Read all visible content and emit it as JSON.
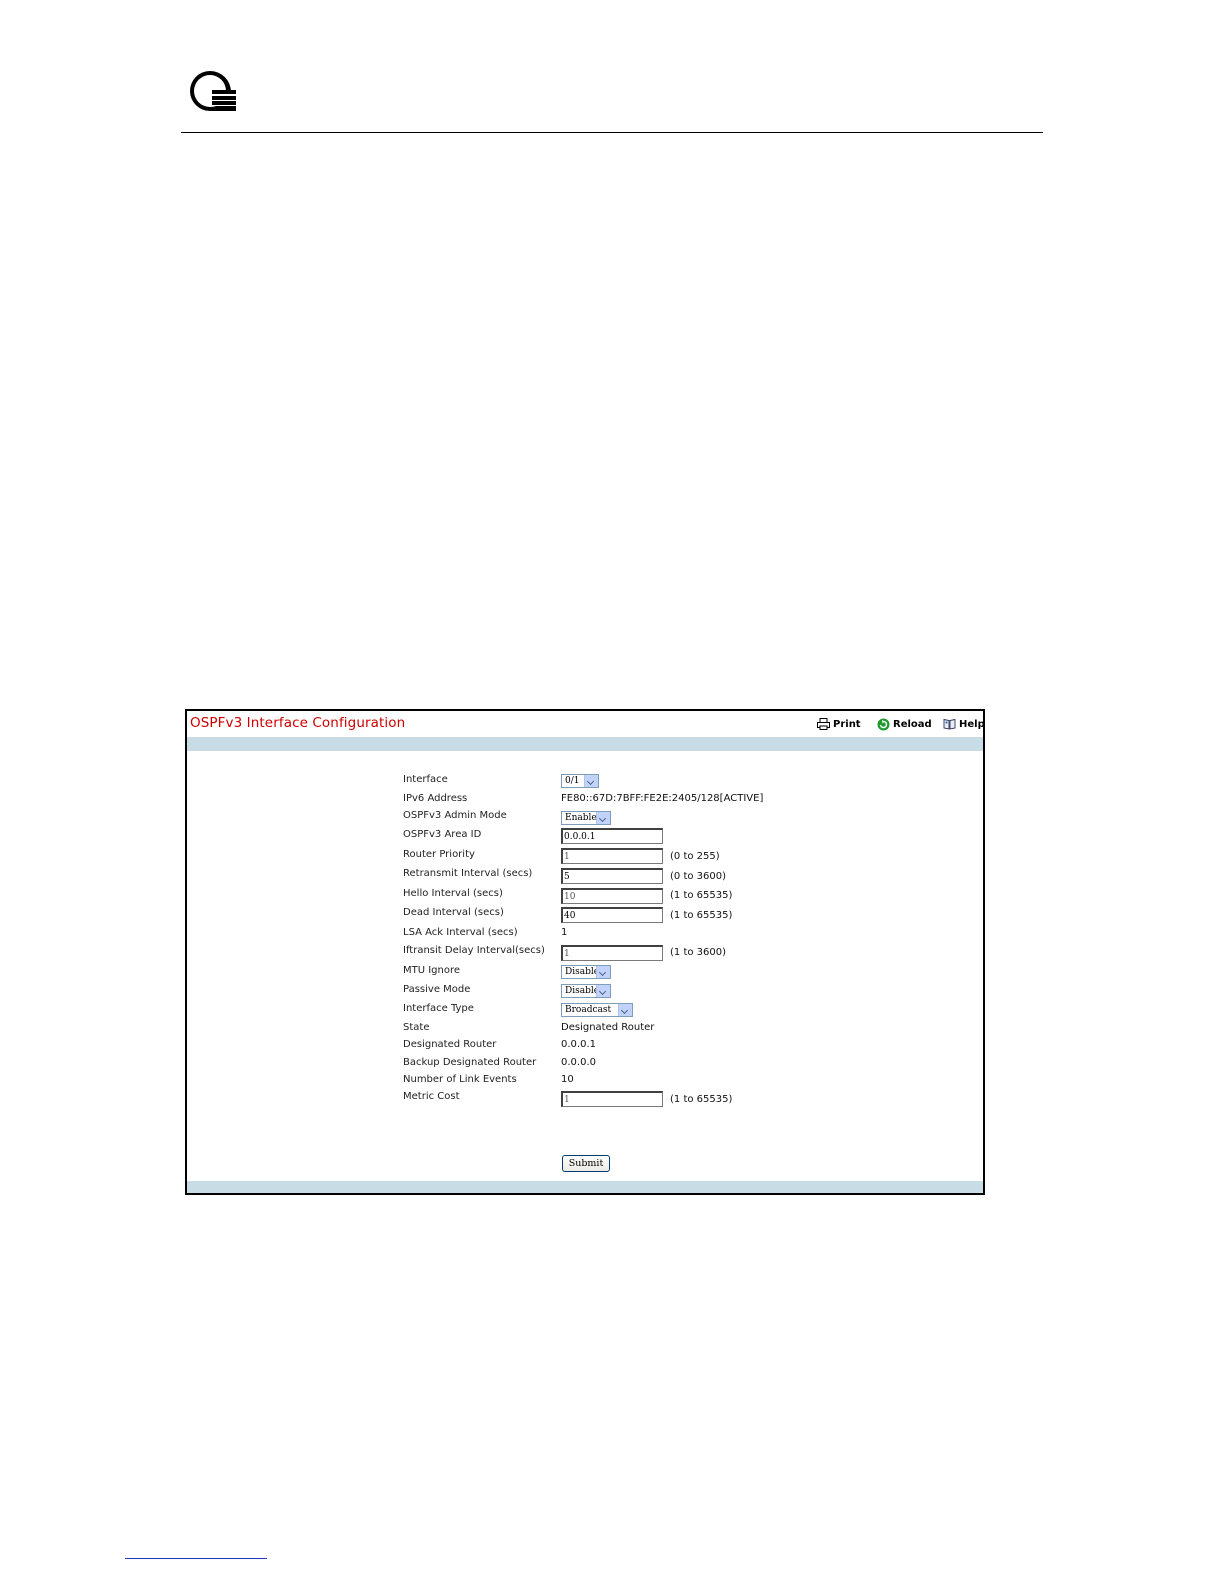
{
  "page": {
    "title": "OSPFv3 Interface Configuration",
    "toolbar": {
      "print": "Print",
      "reload": "Reload",
      "help": "Help"
    }
  },
  "form": {
    "interface": {
      "label": "Interface",
      "value": "0/1"
    },
    "ipv6_address": {
      "label": "IPv6 Address",
      "value": "FE80::67D:7BFF:FE2E:2405/128[ACTIVE]"
    },
    "admin_mode": {
      "label": "OSPFv3 Admin Mode",
      "value": "Enable"
    },
    "area_id": {
      "label": "OSPFv3 Area ID",
      "value": "0.0.0.1"
    },
    "router_priority": {
      "label": "Router Priority",
      "value": "1",
      "range": "(0 to 255)"
    },
    "retransmit": {
      "label": "Retransmit Interval (secs)",
      "value": "5",
      "range": "(0 to 3600)"
    },
    "hello": {
      "label": "Hello Interval (secs)",
      "value": "10",
      "range": "(1 to 65535)"
    },
    "dead": {
      "label": "Dead Interval (secs)",
      "value": "40",
      "range": "(1 to 65535)"
    },
    "lsa_ack": {
      "label": "LSA Ack Interval (secs)",
      "value": "1"
    },
    "iftransit": {
      "label": "Iftransit Delay Interval(secs)",
      "value": "1",
      "range": "(1 to 3600)"
    },
    "mtu_ignore": {
      "label": "MTU Ignore",
      "value": "Disable"
    },
    "passive_mode": {
      "label": "Passive Mode",
      "value": "Disable"
    },
    "interface_type": {
      "label": "Interface Type",
      "value": "Broadcast"
    },
    "state": {
      "label": "State",
      "value": "Designated Router"
    },
    "designated_router": {
      "label": "Designated Router",
      "value": "0.0.0.1"
    },
    "backup_dr": {
      "label": "Backup Designated Router",
      "value": "0.0.0.0"
    },
    "link_events": {
      "label": "Number of Link Events",
      "value": "10"
    },
    "metric_cost": {
      "label": "Metric Cost",
      "value": "1",
      "range": "(1 to 65535)"
    },
    "submit_label": "Submit"
  }
}
